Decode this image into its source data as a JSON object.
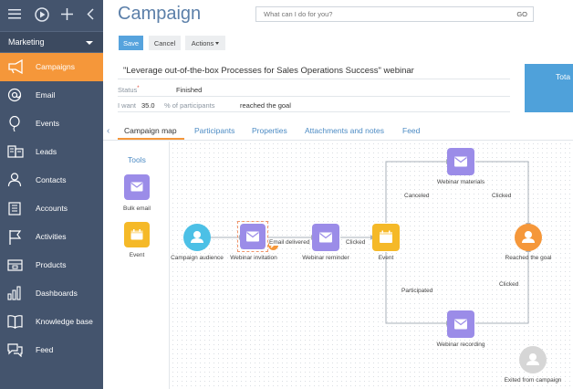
{
  "sidebar": {
    "workspace": "Marketing",
    "items": [
      {
        "label": "Campaigns",
        "icon": "megaphone-icon",
        "active": true
      },
      {
        "label": "Email",
        "icon": "at-sign-icon"
      },
      {
        "label": "Events",
        "icon": "balloon-icon"
      },
      {
        "label": "Leads",
        "icon": "lead-card-icon"
      },
      {
        "label": "Contacts",
        "icon": "person-icon"
      },
      {
        "label": "Accounts",
        "icon": "building-icon"
      },
      {
        "label": "Activities",
        "icon": "flag-icon"
      },
      {
        "label": "Products",
        "icon": "box-icon"
      },
      {
        "label": "Dashboards",
        "icon": "bar-chart-icon"
      },
      {
        "label": "Knowledge base",
        "icon": "book-icon"
      },
      {
        "label": "Feed",
        "icon": "chat-bubbles-icon"
      }
    ]
  },
  "header": {
    "title": "Campaign",
    "search_placeholder": "What can I do for you?",
    "search_go": "GO"
  },
  "toolbar": {
    "save_label": "Save",
    "cancel_label": "Cancel",
    "actions_label": "Actions"
  },
  "record": {
    "name": "\"Leverage out-of-the-box Processes for Sales Operations Success\" webinar",
    "status_label": "Status",
    "status_value": "Finished",
    "goal_label": "I want",
    "goal_value": "35.0",
    "goal_unit": "% of participants",
    "goal_text": "reached the goal",
    "total_label": "Tota"
  },
  "tabs": [
    {
      "label": "Campaign map",
      "active": true
    },
    {
      "label": "Participants"
    },
    {
      "label": "Properties"
    },
    {
      "label": "Attachments and notes"
    },
    {
      "label": "Feed"
    }
  ],
  "tools": {
    "title": "Tools",
    "items": [
      {
        "label": "Bulk email",
        "color": "#9b8ce8",
        "icon": "envelope-icon"
      },
      {
        "label": "Event",
        "color": "#f5b928",
        "icon": "calendar-icon"
      }
    ]
  },
  "flow": {
    "nodes": {
      "audience": "Campaign audience",
      "invitation": "Webinar invitation",
      "reminder": "Webinar reminder",
      "event": "Event",
      "materials": "Webinar materials",
      "recording": "Webinar recording",
      "goal": "Reached the goal",
      "exited": "Exited from campaign"
    },
    "edges": {
      "email_delivered": "Email delivered",
      "clicked_reminder": "Clicked",
      "canceled": "Canceled",
      "clicked_materials": "Clicked",
      "participated": "Participated",
      "clicked_recording": "Clicked"
    },
    "colors": {
      "email": "#9b8ce8",
      "event": "#f5b928",
      "audience": "#4cc0e6",
      "goal": "#f5973a",
      "exited": "#d6d6d6"
    }
  }
}
